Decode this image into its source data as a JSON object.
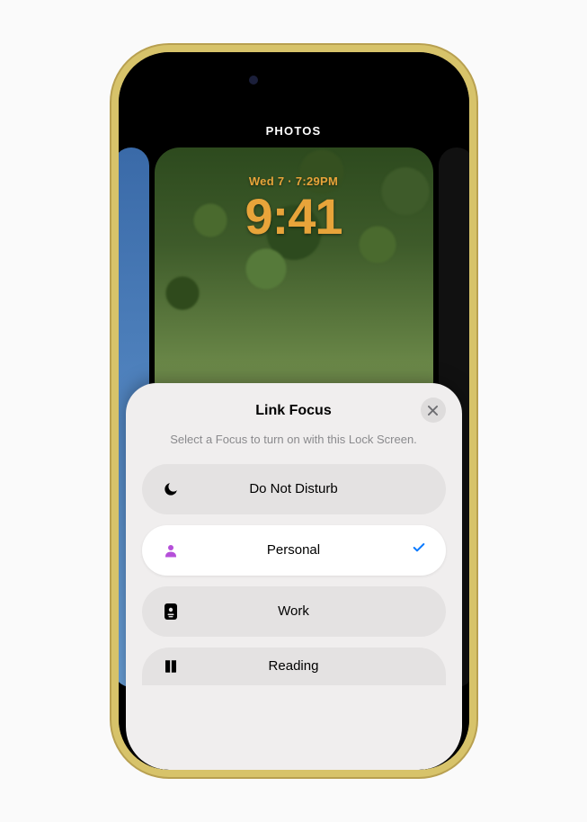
{
  "editor": {
    "style_label": "PHOTOS",
    "lockscreen": {
      "dateline": "Wed 7 · 7:29PM",
      "time": "9:41"
    }
  },
  "sheet": {
    "title": "Link Focus",
    "subtitle": "Select a Focus to turn on with this Lock Screen.",
    "close_icon": "close-icon",
    "items": [
      {
        "id": "dnd",
        "label": "Do Not Disturb",
        "icon": "moon-icon",
        "icon_color": "#000000",
        "selected": false
      },
      {
        "id": "personal",
        "label": "Personal",
        "icon": "person-icon",
        "icon_color": "#b54fd9",
        "selected": true
      },
      {
        "id": "work",
        "label": "Work",
        "icon": "badge-icon",
        "icon_color": "#000000",
        "selected": false
      },
      {
        "id": "reading",
        "label": "Reading",
        "icon": "book-icon",
        "icon_color": "#000000",
        "selected": false
      }
    ]
  }
}
